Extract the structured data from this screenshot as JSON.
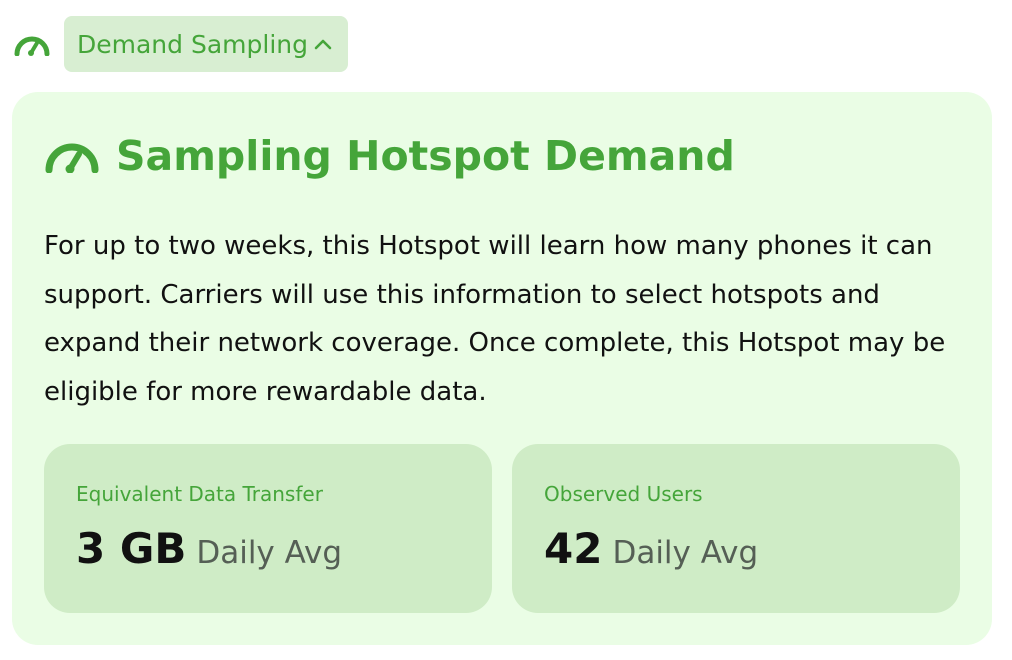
{
  "header": {
    "icon": "gauge-icon",
    "toggle_label": "Demand Sampling",
    "toggle_icon": "chevron-up-icon"
  },
  "card": {
    "icon": "gauge-icon",
    "title": "Sampling Hotspot Demand",
    "description": "For up to two weeks, this Hotspot will learn how many phones it can support. Carriers will use this information to select hotspots and expand their network coverage. Once complete, this Hotspot may be eligible for more rewardable data.",
    "stats": [
      {
        "label": "Equivalent Data Transfer",
        "value": "3 GB",
        "unit": "Daily Avg"
      },
      {
        "label": "Observed Users",
        "value": "42",
        "unit": "Daily Avg"
      }
    ]
  },
  "colors": {
    "accent": "#45a53a",
    "card_bg": "#eafde5",
    "stat_bg": "#cfecc6",
    "toggle_bg": "#d8eed2"
  }
}
